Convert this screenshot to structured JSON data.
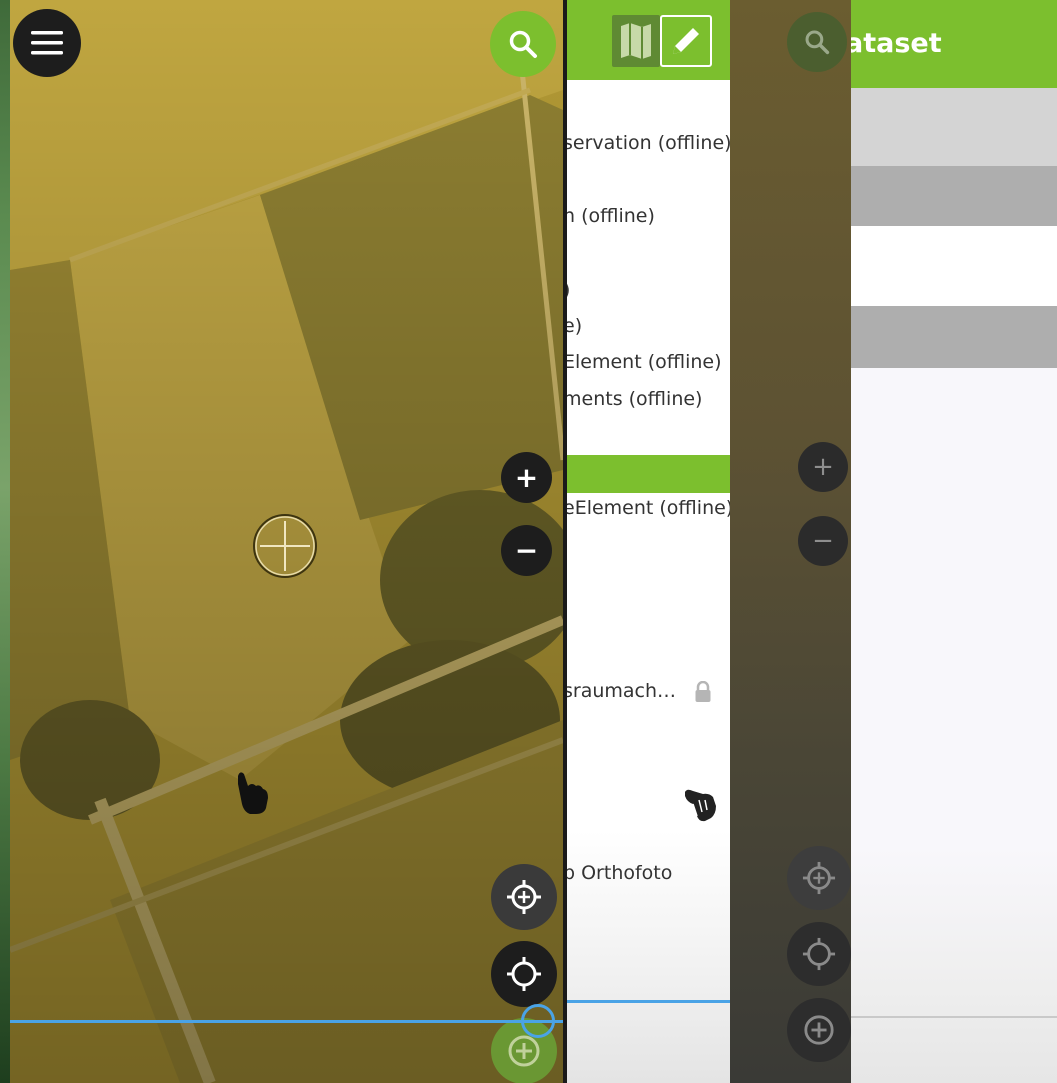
{
  "colors": {
    "accent_green": "#7cbf2e",
    "map_yellow": "#b39a35",
    "scroll_blue": "#4aa3e6",
    "dark_button": "#1d1d1d"
  },
  "map": {
    "menu_icon": "hamburger-menu-icon",
    "search_icon": "search-icon",
    "zoom_in_label": "+",
    "zoom_out_label": "−",
    "locate_add_icon": "crosshair-add-icon",
    "locate_icon": "gps-locate-icon",
    "add_icon": "add-point-icon"
  },
  "layer_list": {
    "toolbar": {
      "map_icon": "map-icon",
      "edit_icon": "pencil-icon"
    },
    "items": [
      "servation (offline)",
      "n (offline)",
      ")",
      "e)",
      "Element (offline)",
      "ments (offline)",
      "eElement (offline)",
      "sraumach…",
      "p Orthofoto"
    ],
    "lock_icon": "lock-icon"
  },
  "dataset": {
    "title": "ataset"
  }
}
